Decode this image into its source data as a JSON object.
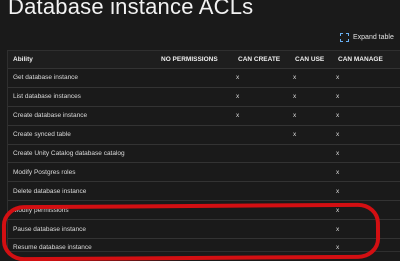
{
  "page": {
    "title": "Database instance ACLs"
  },
  "toolbar": {
    "expand_label": "Expand table",
    "expand_icon": "expand-icon"
  },
  "table": {
    "headers": {
      "ability": "Ability",
      "none": "NO PERMISSIONS",
      "create": "CAN CREATE",
      "use": "CAN USE",
      "manage": "CAN MANAGE"
    },
    "rows": [
      {
        "ability": "Get database instance",
        "none": "",
        "create": "x",
        "use": "x",
        "manage": "x"
      },
      {
        "ability": "List database instances",
        "none": "",
        "create": "x",
        "use": "x",
        "manage": "x"
      },
      {
        "ability": "Create database instance",
        "none": "",
        "create": "x",
        "use": "x",
        "manage": "x"
      },
      {
        "ability": "Create synced table",
        "none": "",
        "create": "",
        "use": "x",
        "manage": "x"
      },
      {
        "ability": "Create Unity Catalog database catalog",
        "none": "",
        "create": "",
        "use": "",
        "manage": "x"
      },
      {
        "ability": "Modify Postgres roles",
        "none": "",
        "create": "",
        "use": "",
        "manage": "x"
      },
      {
        "ability": "Delete database instance",
        "none": "",
        "create": "",
        "use": "",
        "manage": "x"
      },
      {
        "ability": "Modify permissions",
        "none": "",
        "create": "",
        "use": "",
        "manage": "x"
      },
      {
        "ability": "Pause database instance",
        "none": "",
        "create": "",
        "use": "",
        "manage": "x"
      },
      {
        "ability": "Resume database instance",
        "none": "",
        "create": "",
        "use": "",
        "manage": "x"
      }
    ]
  },
  "colors": {
    "background": "#1a1a1a",
    "highlight": "#d30f12",
    "icon_accent": "#6ab0f3"
  }
}
